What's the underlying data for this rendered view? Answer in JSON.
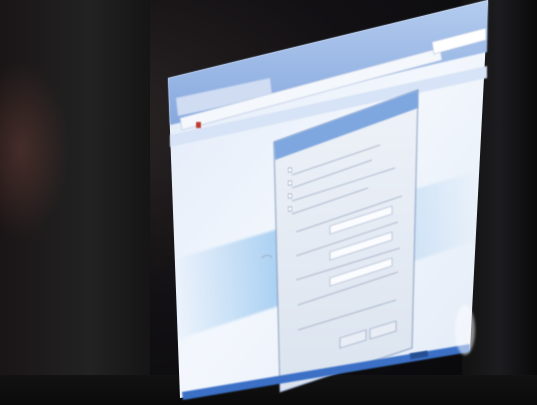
{
  "photo": {
    "subject": "",
    "colors": {
      "screen_bg": "#eef3fb",
      "window_chrome": "#8fb1e3",
      "dialog_bg": "#e8edf5",
      "dialog_title": "#7ba3dd",
      "dark_frame": "#111114"
    }
  }
}
